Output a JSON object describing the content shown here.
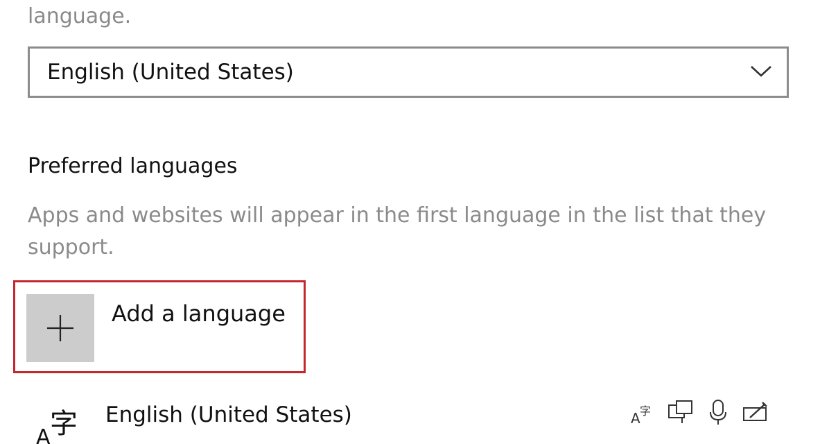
{
  "top_fragment": "language.",
  "display_language_select": {
    "value": "English (United States)"
  },
  "preferred_languages": {
    "title": "Preferred languages",
    "description": "Apps and websites will appear in the first language in the list that they support.",
    "add_button_label": "Add a language",
    "list": [
      {
        "name": "English (United States)",
        "icon": "language-character-icon",
        "features": [
          "display-language-icon",
          "text-to-speech-icon",
          "speech-recognition-icon",
          "handwriting-icon"
        ]
      }
    ]
  },
  "colors": {
    "highlight": "#c4262e",
    "tile": "#cccccc",
    "secondary_text": "#8a8a8a"
  }
}
